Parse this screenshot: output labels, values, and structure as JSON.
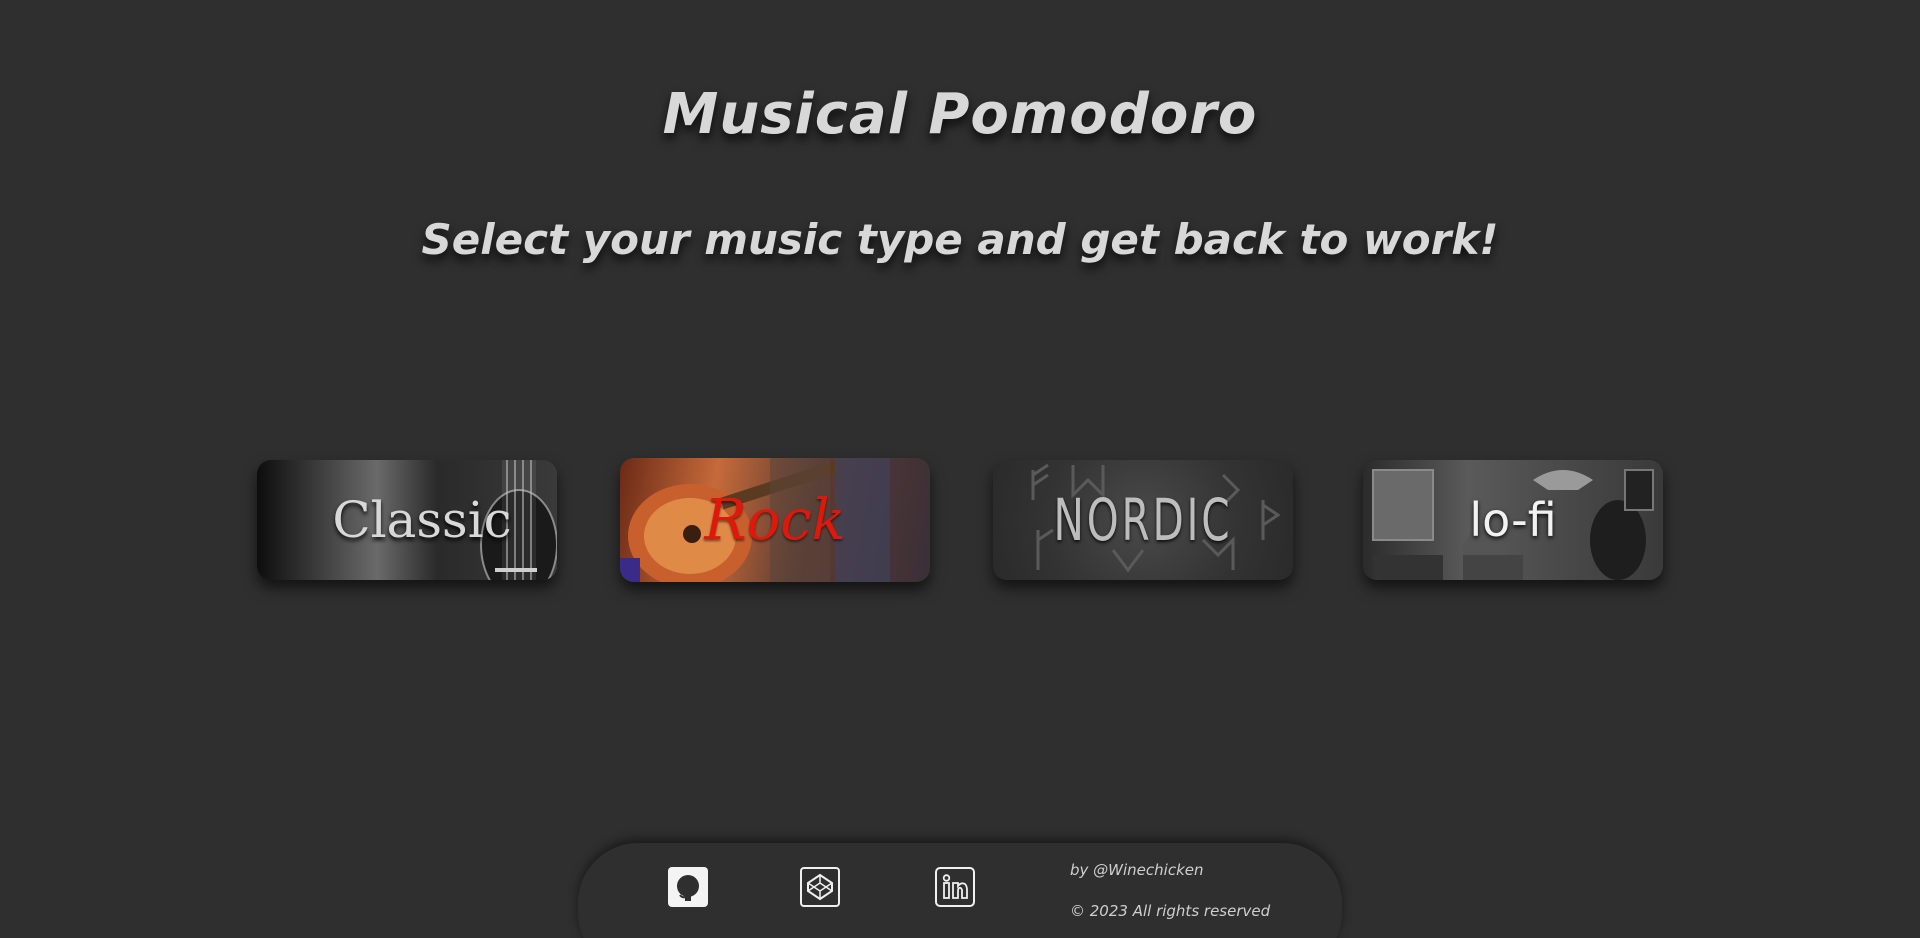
{
  "header": {
    "title": "Musical Pomodoro",
    "subtitle": "Select your music type and get back to work!"
  },
  "cards": [
    {
      "id": "classic",
      "label": "Classic"
    },
    {
      "id": "rock",
      "label": "Rock"
    },
    {
      "id": "nordic",
      "label": "NORDIC"
    },
    {
      "id": "lofi",
      "label": "lo-fi"
    }
  ],
  "footer": {
    "icons": [
      "github-icon",
      "codepen-icon",
      "linkedin-icon"
    ],
    "author": "by @Winechicken",
    "copyright": "© 2023 All rights reserved"
  },
  "colors": {
    "background": "#2f2f2f",
    "text": "#d8d8d8",
    "rock_label": "#e0180c"
  }
}
